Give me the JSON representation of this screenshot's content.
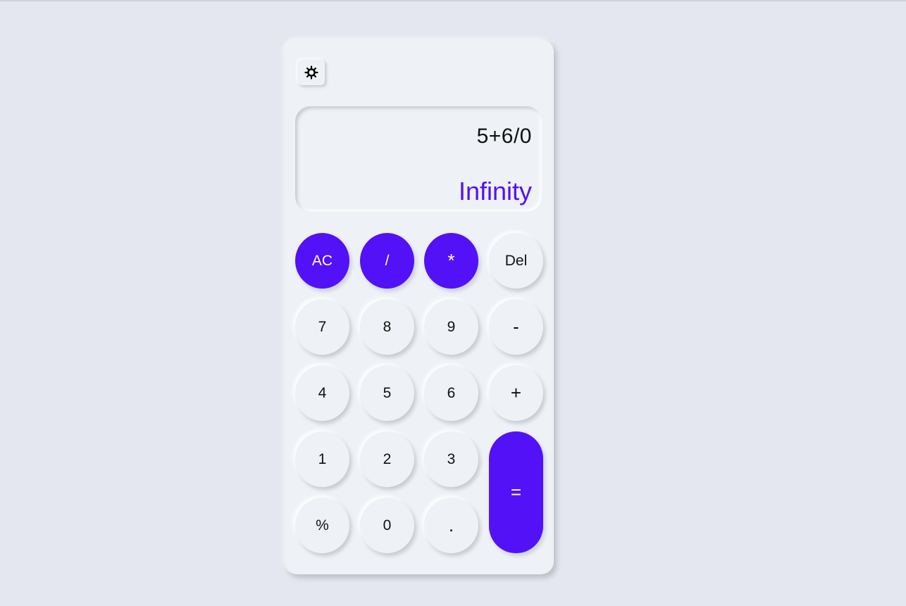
{
  "theme_toggle": {
    "icon": "sun-icon"
  },
  "display": {
    "expression": "5+6/0",
    "result": "Infinity"
  },
  "keys": {
    "ac": "AC",
    "divide": "/",
    "multiply": "*",
    "del": "Del",
    "seven": "7",
    "eight": "8",
    "nine": "9",
    "minus": "-",
    "four": "4",
    "five": "5",
    "six": "6",
    "plus": "+",
    "one": "1",
    "two": "2",
    "three": "3",
    "equals": "=",
    "percent": "%",
    "zero": "0",
    "dot": "."
  },
  "colors": {
    "accent": "#5211f6",
    "background": "#e4e7ef",
    "panel": "#eef1f5"
  }
}
